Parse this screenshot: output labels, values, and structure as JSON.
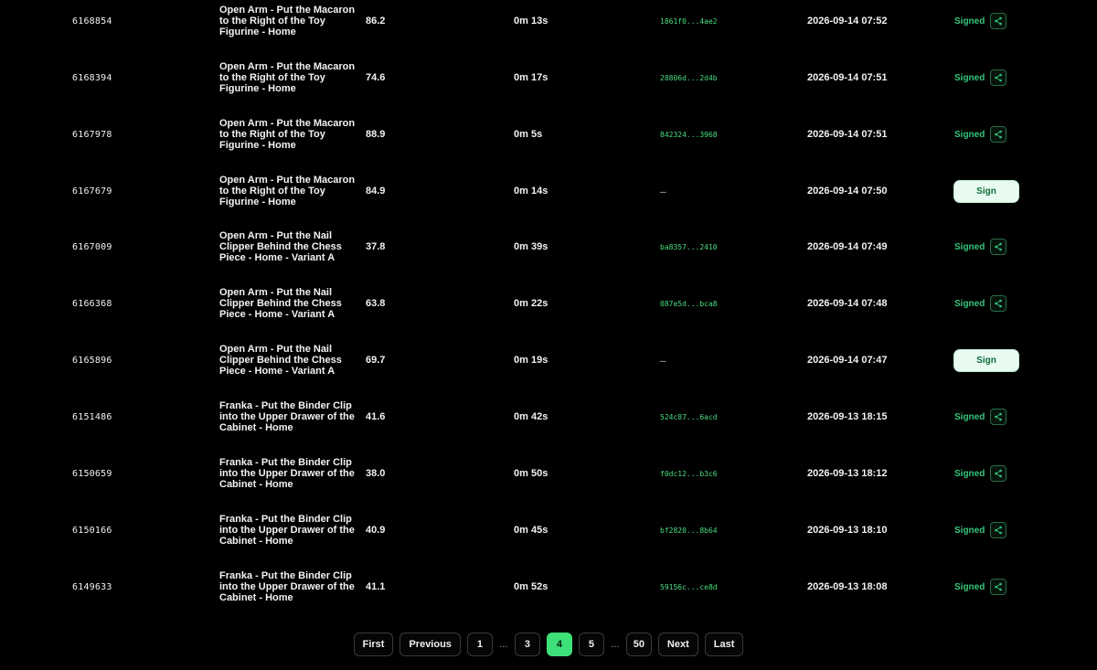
{
  "colors": {
    "background": "#000000",
    "signed_green": "#36c57a",
    "hash_green": "#4ade80",
    "active_page": "#3ee07a"
  },
  "icons": {
    "share": "share-icon"
  },
  "rows": [
    {
      "id": "6168854",
      "task": "Open Arm - Put the Macaron to the Right of the Toy Figurine - Home",
      "score": "86.2",
      "duration": "0m 13s",
      "hash": "1861f0...4ae2",
      "date": "2026-09-14 07:52",
      "status": "Signed"
    },
    {
      "id": "6168394",
      "task": "Open Arm - Put the Macaron to the Right of the Toy Figurine - Home",
      "score": "74.6",
      "duration": "0m 17s",
      "hash": "28806d...2d4b",
      "date": "2026-09-14 07:51",
      "status": "Signed"
    },
    {
      "id": "6167978",
      "task": "Open Arm - Put the Macaron to the Right of the Toy Figurine - Home",
      "score": "88.9",
      "duration": "0m 5s",
      "hash": "842324...3968",
      "date": "2026-09-14 07:51",
      "status": "Signed"
    },
    {
      "id": "6167679",
      "task": "Open Arm - Put the Macaron to the Right of the Toy Figurine - Home",
      "score": "84.9",
      "duration": "0m 14s",
      "hash": "—",
      "date": "2026-09-14 07:50",
      "status": "Sign"
    },
    {
      "id": "6167009",
      "task": "Open Arm - Put the Nail Clipper Behind the Chess Piece - Home - Variant A",
      "score": "37.8",
      "duration": "0m 39s",
      "hash": "ba8357...2410",
      "date": "2026-09-14 07:49",
      "status": "Signed"
    },
    {
      "id": "6166368",
      "task": "Open Arm - Put the Nail Clipper Behind the Chess Piece - Home - Variant A",
      "score": "63.8",
      "duration": "0m 22s",
      "hash": "087e5d...bca8",
      "date": "2026-09-14 07:48",
      "status": "Signed"
    },
    {
      "id": "6165896",
      "task": "Open Arm - Put the Nail Clipper Behind the Chess Piece - Home - Variant A",
      "score": "69.7",
      "duration": "0m 19s",
      "hash": "—",
      "date": "2026-09-14 07:47",
      "status": "Sign"
    },
    {
      "id": "6151486",
      "task": "Franka - Put the Binder Clip into the Upper Drawer of the Cabinet - Home",
      "score": "41.6",
      "duration": "0m 42s",
      "hash": "524c87...6acd",
      "date": "2026-09-13 18:15",
      "status": "Signed"
    },
    {
      "id": "6150659",
      "task": "Franka - Put the Binder Clip into the Upper Drawer of the Cabinet - Home",
      "score": "38.0",
      "duration": "0m 50s",
      "hash": "f0dc12...b3c6",
      "date": "2026-09-13 18:12",
      "status": "Signed"
    },
    {
      "id": "6150166",
      "task": "Franka - Put the Binder Clip into the Upper Drawer of the Cabinet - Home",
      "score": "40.9",
      "duration": "0m 45s",
      "hash": "bf2820...8b64",
      "date": "2026-09-13 18:10",
      "status": "Signed"
    },
    {
      "id": "6149633",
      "task": "Franka - Put the Binder Clip into the Upper Drawer of the Cabinet - Home",
      "score": "41.1",
      "duration": "0m 52s",
      "hash": "59156c...ce8d",
      "date": "2026-09-13 18:08",
      "status": "Signed"
    }
  ],
  "pagination": {
    "first": "First",
    "previous": "Previous",
    "next": "Next",
    "last": "Last",
    "ellipsis": "...",
    "pages": [
      "1",
      "...",
      "3",
      "4",
      "5",
      "...",
      "50"
    ],
    "current": "4"
  }
}
